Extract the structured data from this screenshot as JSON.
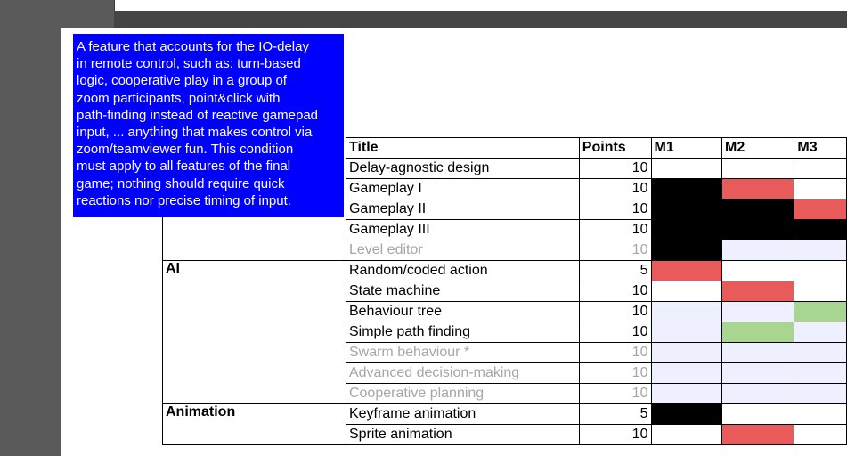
{
  "tooltip": {
    "lines": [
      "A feature that accounts for the IO-delay",
      "in remote control, such as: turn-based",
      "logic, cooperative play in a group of",
      "zoom participants, point&click with",
      "path-finding instead of reactive gamepad",
      "input, ... anything that makes control via",
      "zoom/teamviewer fun. This condition",
      "must apply to all features of the final",
      "game; nothing should require quick",
      "reactions nor precise timing of input."
    ]
  },
  "table": {
    "headers": {
      "title": "Title",
      "points": "Points",
      "m1": "M1",
      "m2": "M2",
      "m3": "M3"
    },
    "rows": [
      {
        "category": "",
        "title": "Delay-agnostic design",
        "points": "10",
        "muted": false,
        "marks": [
          "blank",
          "blank",
          "blank"
        ]
      },
      {
        "category": "",
        "title": "Gameplay I",
        "points": "10",
        "muted": false,
        "marks": [
          "black",
          "red",
          "blank"
        ]
      },
      {
        "category": "",
        "title": "Gameplay II",
        "points": "10",
        "muted": false,
        "marks": [
          "black",
          "black",
          "red"
        ]
      },
      {
        "category": "",
        "title": "Gameplay III",
        "points": "10",
        "muted": false,
        "marks": [
          "black",
          "black",
          "black"
        ]
      },
      {
        "category": "",
        "title": "Level editor",
        "points": "10",
        "muted": true,
        "marks": [
          "black",
          "lav",
          "lav"
        ]
      },
      {
        "category": "AI",
        "title": "Random/coded action",
        "points": "5",
        "muted": false,
        "marks": [
          "red",
          "blank",
          "blank"
        ]
      },
      {
        "category": "",
        "title": "State machine",
        "points": "10",
        "muted": false,
        "marks": [
          "blank",
          "red",
          "blank"
        ]
      },
      {
        "category": "",
        "title": "Behaviour tree",
        "points": "10",
        "muted": false,
        "marks": [
          "lav",
          "lav",
          "green"
        ]
      },
      {
        "category": "",
        "title": "Simple path finding",
        "points": "10",
        "muted": false,
        "marks": [
          "lav",
          "green",
          "lav"
        ]
      },
      {
        "category": "",
        "title": "Swarm behaviour *",
        "points": "10",
        "muted": true,
        "marks": [
          "lav",
          "lav",
          "lav"
        ]
      },
      {
        "category": "",
        "title": "Advanced decision-making",
        "points": "10",
        "muted": true,
        "marks": [
          "lav",
          "lav",
          "lav"
        ]
      },
      {
        "category": "",
        "title": "Cooperative planning",
        "points": "10",
        "muted": true,
        "marks": [
          "lav",
          "lav",
          "lav"
        ]
      },
      {
        "category": "Animation",
        "title": "Keyframe animation",
        "points": "5",
        "muted": false,
        "marks": [
          "black",
          "blank",
          "blank"
        ]
      },
      {
        "category": "",
        "title": "Sprite animation",
        "points": "10",
        "muted": false,
        "marks": [
          "blank",
          "red",
          "blank"
        ]
      }
    ]
  },
  "colors": {
    "tooltip_bg": "#0000ff",
    "black": "#000000",
    "red": "#e95b5b",
    "green": "#a8d58f",
    "lav": "#eef0ff",
    "muted_text": "#a6a6a6"
  }
}
